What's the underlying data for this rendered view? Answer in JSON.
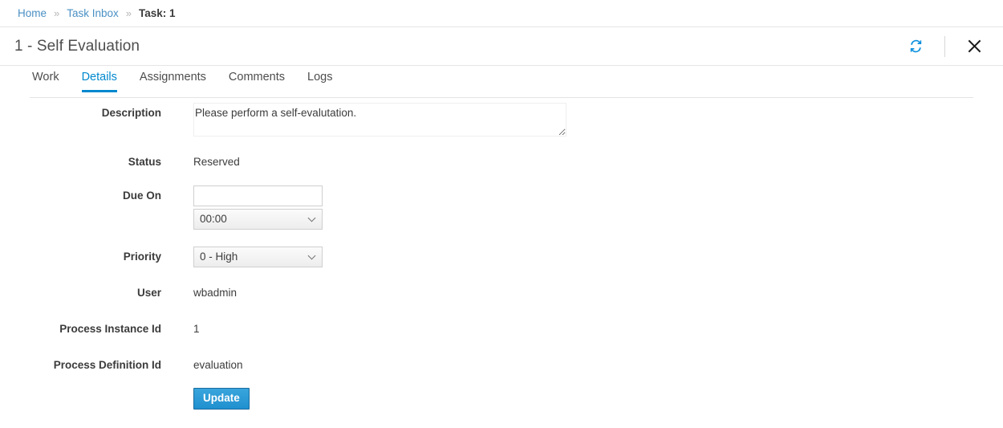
{
  "breadcrumb": {
    "items": [
      {
        "label": "Home",
        "type": "link"
      },
      {
        "label": "Task Inbox",
        "type": "link"
      },
      {
        "label": "Task: 1",
        "type": "current"
      }
    ],
    "separator": "»"
  },
  "header": {
    "title": "1 - Self Evaluation",
    "refresh_icon": "refresh-icon",
    "close_icon": "close-icon"
  },
  "tabs": [
    {
      "label": "Work",
      "active": false
    },
    {
      "label": "Details",
      "active": true
    },
    {
      "label": "Assignments",
      "active": false
    },
    {
      "label": "Comments",
      "active": false
    },
    {
      "label": "Logs",
      "active": false
    }
  ],
  "form": {
    "description": {
      "label": "Description",
      "value": "Please perform a self-evalutation."
    },
    "status": {
      "label": "Status",
      "value": "Reserved"
    },
    "due_on": {
      "label": "Due On",
      "date_value": "",
      "date_placeholder": "",
      "time_value": "00:00"
    },
    "priority": {
      "label": "Priority",
      "value": "0 - High"
    },
    "user": {
      "label": "User",
      "value": "wbadmin"
    },
    "process_instance_id": {
      "label": "Process Instance Id",
      "value": "1"
    },
    "process_definition_id": {
      "label": "Process Definition Id",
      "value": "evaluation"
    },
    "update_button": "Update"
  },
  "colors": {
    "accent": "#0088ce",
    "link": "#4a90c4",
    "button": "#1f90cf",
    "border": "#e5e5e5"
  }
}
